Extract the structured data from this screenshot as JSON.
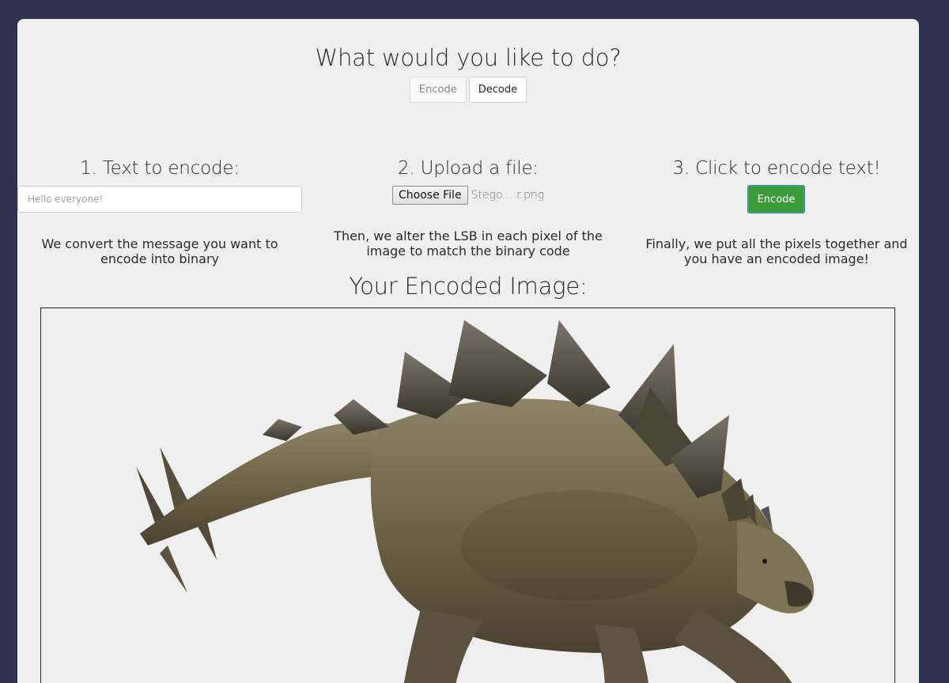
{
  "header": {
    "question": "What would you like to do?",
    "modes": [
      {
        "label": "Encode",
        "active": false
      },
      {
        "label": "Decode",
        "active": true
      }
    ]
  },
  "steps": [
    {
      "title": "1. Text to encode:",
      "description": "We convert the message you want to encode into binary"
    },
    {
      "title": "2. Upload a file:",
      "description": "Then, we alter the LSB in each pixel of the image to match the binary code"
    },
    {
      "title": "3. Click to encode text!",
      "description": "Finally, we put all the pixels together and you have an encoded image!"
    }
  ],
  "text_input": {
    "value": "Hello everyone!"
  },
  "file_input": {
    "button_label": "Choose File",
    "file_name": "Stego....r.png"
  },
  "encode_button": {
    "label": "Encode"
  },
  "result": {
    "title": "Your Encoded Image:",
    "image_subject": "stegosaurus"
  },
  "colors": {
    "page_background": "#2e3250",
    "card_background": "#efefef",
    "encode_button": "#3a9b3a"
  }
}
